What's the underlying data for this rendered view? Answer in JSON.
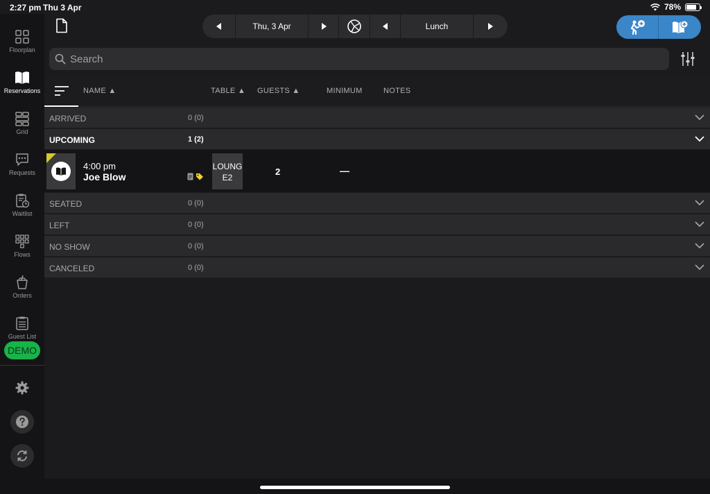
{
  "status": {
    "time": "2:27 pm",
    "date": "Thu 3 Apr",
    "battery": "78%",
    "battery_level": 0.78
  },
  "sidebar": {
    "items": [
      {
        "label": "Floorplan",
        "icon": "floorplan-icon"
      },
      {
        "label": "Reservations",
        "icon": "book-icon",
        "active": true
      },
      {
        "label": "Grid",
        "icon": "grid-icon"
      },
      {
        "label": "Requests",
        "icon": "chat-icon"
      },
      {
        "label": "Waitlist",
        "icon": "clipboard-clock-icon"
      },
      {
        "label": "Flows",
        "icon": "flows-icon"
      },
      {
        "label": "Orders",
        "icon": "drink-icon"
      },
      {
        "label": "Guest List",
        "icon": "list-icon"
      }
    ],
    "demo_badge": "DEMO"
  },
  "header": {
    "date_label": "Thu, 3 Apr",
    "shift_label": "Lunch"
  },
  "search": {
    "placeholder": "Search"
  },
  "columns": {
    "name": "NAME",
    "table": "TABLE",
    "guests": "GUESTS",
    "minimum": "MINIMUM",
    "notes": "NOTES"
  },
  "groups": [
    {
      "name": "ARRIVED",
      "count": "0 (0)"
    },
    {
      "name": "UPCOMING",
      "count": "1 (2)"
    },
    {
      "name": "SEATED",
      "count": "0 (0)"
    },
    {
      "name": "LEFT",
      "count": "0 (0)"
    },
    {
      "name": "NO SHOW",
      "count": "0 (0)"
    },
    {
      "name": "CANCELED",
      "count": "0 (0)"
    }
  ],
  "reservation": {
    "time": "4:00 pm",
    "name": "Joe Blow",
    "table_area": "LOUNG",
    "table_id": "E2",
    "guests": "2",
    "minimum": "—"
  },
  "colors": {
    "accent": "#3a86c8",
    "demo": "#19b34a",
    "flag": "#d7c82a"
  }
}
